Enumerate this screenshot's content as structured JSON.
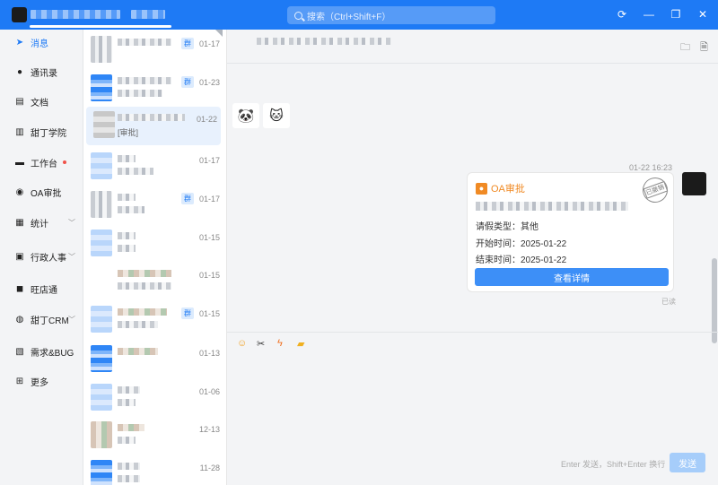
{
  "search": {
    "placeholder": "搜索（Ctrl+Shift+F）"
  },
  "window_controls": [
    "refresh-icon",
    "minimize-icon",
    "maximize-icon",
    "close-icon"
  ],
  "nav": [
    {
      "label": "消息",
      "icon": "send-icon",
      "active": true
    },
    {
      "label": "通讯录",
      "icon": "person-icon"
    },
    {
      "label": "文档",
      "icon": "document-icon"
    },
    {
      "label": "甜丁学院",
      "icon": "books-icon"
    },
    {
      "label": "工作台",
      "icon": "monitor-icon",
      "dot": true
    },
    {
      "label": "OA审批",
      "icon": "user-circle-icon"
    },
    {
      "label": "统计",
      "icon": "chart-icon",
      "chevron": true
    },
    {
      "label": "行政人事",
      "icon": "clipboard-icon",
      "chevron": true
    },
    {
      "label": "旺店通",
      "icon": "shop-icon"
    },
    {
      "label": "甜丁CRM",
      "icon": "crm-icon",
      "chevron": true
    },
    {
      "label": "需求&BUG",
      "icon": "bug-icon"
    },
    {
      "label": "更多",
      "icon": "grid-icon"
    }
  ],
  "conversations": [
    {
      "time": "01-17",
      "tag": "群"
    },
    {
      "time": "01-23",
      "tag": "群"
    },
    {
      "time": "01-22",
      "preview": "[审批]",
      "selected": true
    },
    {
      "time": "01-17"
    },
    {
      "time": "01-17",
      "tag": "群"
    },
    {
      "time": "01-15"
    },
    {
      "time": "01-15"
    },
    {
      "time": "01-15",
      "tag": "群"
    },
    {
      "time": "01-13"
    },
    {
      "time": "01-06"
    },
    {
      "time": "12-13"
    },
    {
      "time": "11-28"
    }
  ],
  "chat": {
    "message_time": "01-22 16:23",
    "card": {
      "title": "OA审批",
      "stamp": "已撤销",
      "leave_type_label": "请假类型：",
      "leave_type_value": "其他",
      "start_label": "开始时间：",
      "start_value": "2025-01-22",
      "end_label": "结束时间：",
      "end_value": "2025-01-22",
      "button": "查看详情"
    },
    "read_status": "已读",
    "composer_hint": "Enter 发送，Shift+Enter 换行",
    "send_label": "发送"
  }
}
